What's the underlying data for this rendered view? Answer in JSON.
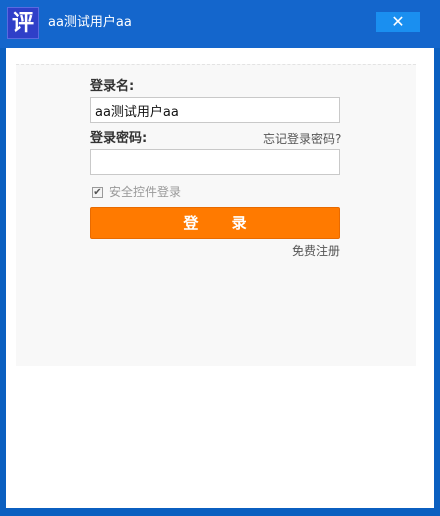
{
  "window": {
    "title": "aa测试用户aa",
    "icon_glyph": "评",
    "close_glyph": "✕"
  },
  "form": {
    "username_label": "登录名:",
    "username_value": "aa测试用户aa",
    "password_label": "登录密码:",
    "password_value": "",
    "forgot_password": "忘记登录密码?",
    "secure_control_checked": true,
    "secure_control_label": "安全控件登录",
    "login_button": "登 录",
    "register_link": "免费注册"
  },
  "colors": {
    "titlebar": "#1466cc",
    "close_button": "#1a8ff0",
    "login_button": "#ff7a00",
    "panel": "#f8f8f8"
  }
}
